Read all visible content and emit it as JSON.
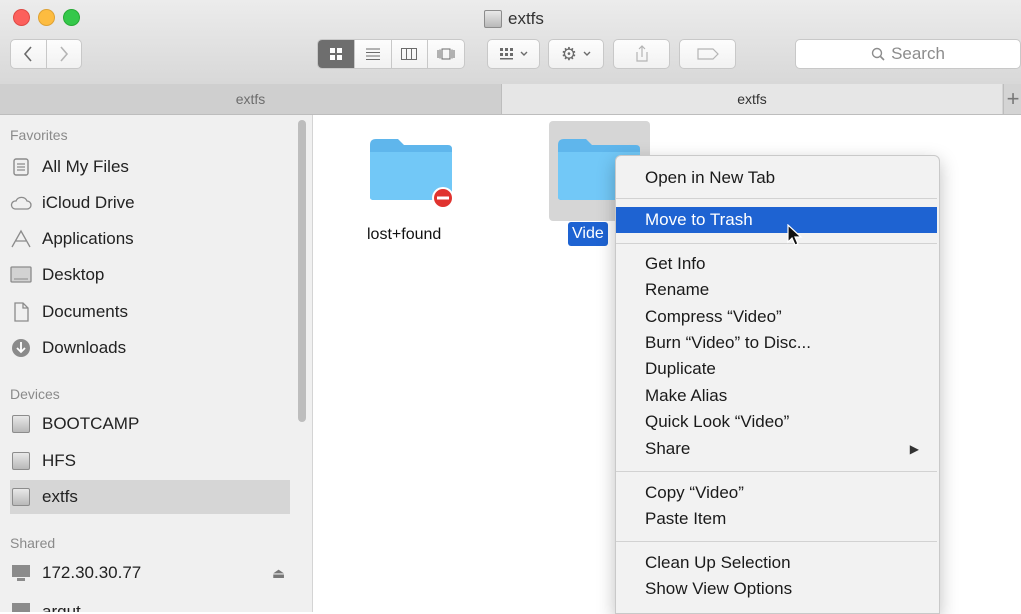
{
  "window": {
    "title": "extfs"
  },
  "toolbar": {
    "back_icon": "chevron-left-icon",
    "forward_icon": "chevron-right-icon",
    "search_placeholder": "Search"
  },
  "tabs": [
    {
      "label": "extfs"
    },
    {
      "label": "extfs"
    }
  ],
  "sidebar": {
    "favorites_header": "Favorites",
    "favorites": [
      {
        "label": "All My Files",
        "icon": "all-files-icon"
      },
      {
        "label": "iCloud Drive",
        "icon": "cloud-icon"
      },
      {
        "label": "Applications",
        "icon": "applications-icon"
      },
      {
        "label": "Desktop",
        "icon": "desktop-icon"
      },
      {
        "label": "Documents",
        "icon": "documents-icon"
      },
      {
        "label": "Downloads",
        "icon": "downloads-icon"
      }
    ],
    "devices_header": "Devices",
    "devices": [
      {
        "label": "BOOTCAMP"
      },
      {
        "label": "HFS"
      },
      {
        "label": "extfs"
      }
    ],
    "shared_header": "Shared",
    "shared": [
      {
        "label": "172.30.30.77"
      },
      {
        "label": "argut"
      }
    ]
  },
  "files": [
    {
      "name": "lost+found"
    },
    {
      "name": "Video",
      "visible_name": "Vide"
    }
  ],
  "context_menu": {
    "items": [
      {
        "label": "Open in New Tab"
      },
      {
        "label": "Move to Trash"
      },
      {
        "label": "Get Info"
      },
      {
        "label": "Rename"
      },
      {
        "label": "Compress “Video”"
      },
      {
        "label": "Burn “Video” to Disc..."
      },
      {
        "label": "Duplicate"
      },
      {
        "label": "Make Alias"
      },
      {
        "label": "Quick Look “Video”"
      },
      {
        "label": "Share"
      },
      {
        "label": "Copy “Video”"
      },
      {
        "label": "Paste Item"
      },
      {
        "label": "Clean Up Selection"
      },
      {
        "label": "Show View Options"
      }
    ],
    "highlighted": "Move to Trash"
  },
  "colors": {
    "selection_blue": "#1e63d2",
    "folder_blue": "#6cc4f5"
  }
}
